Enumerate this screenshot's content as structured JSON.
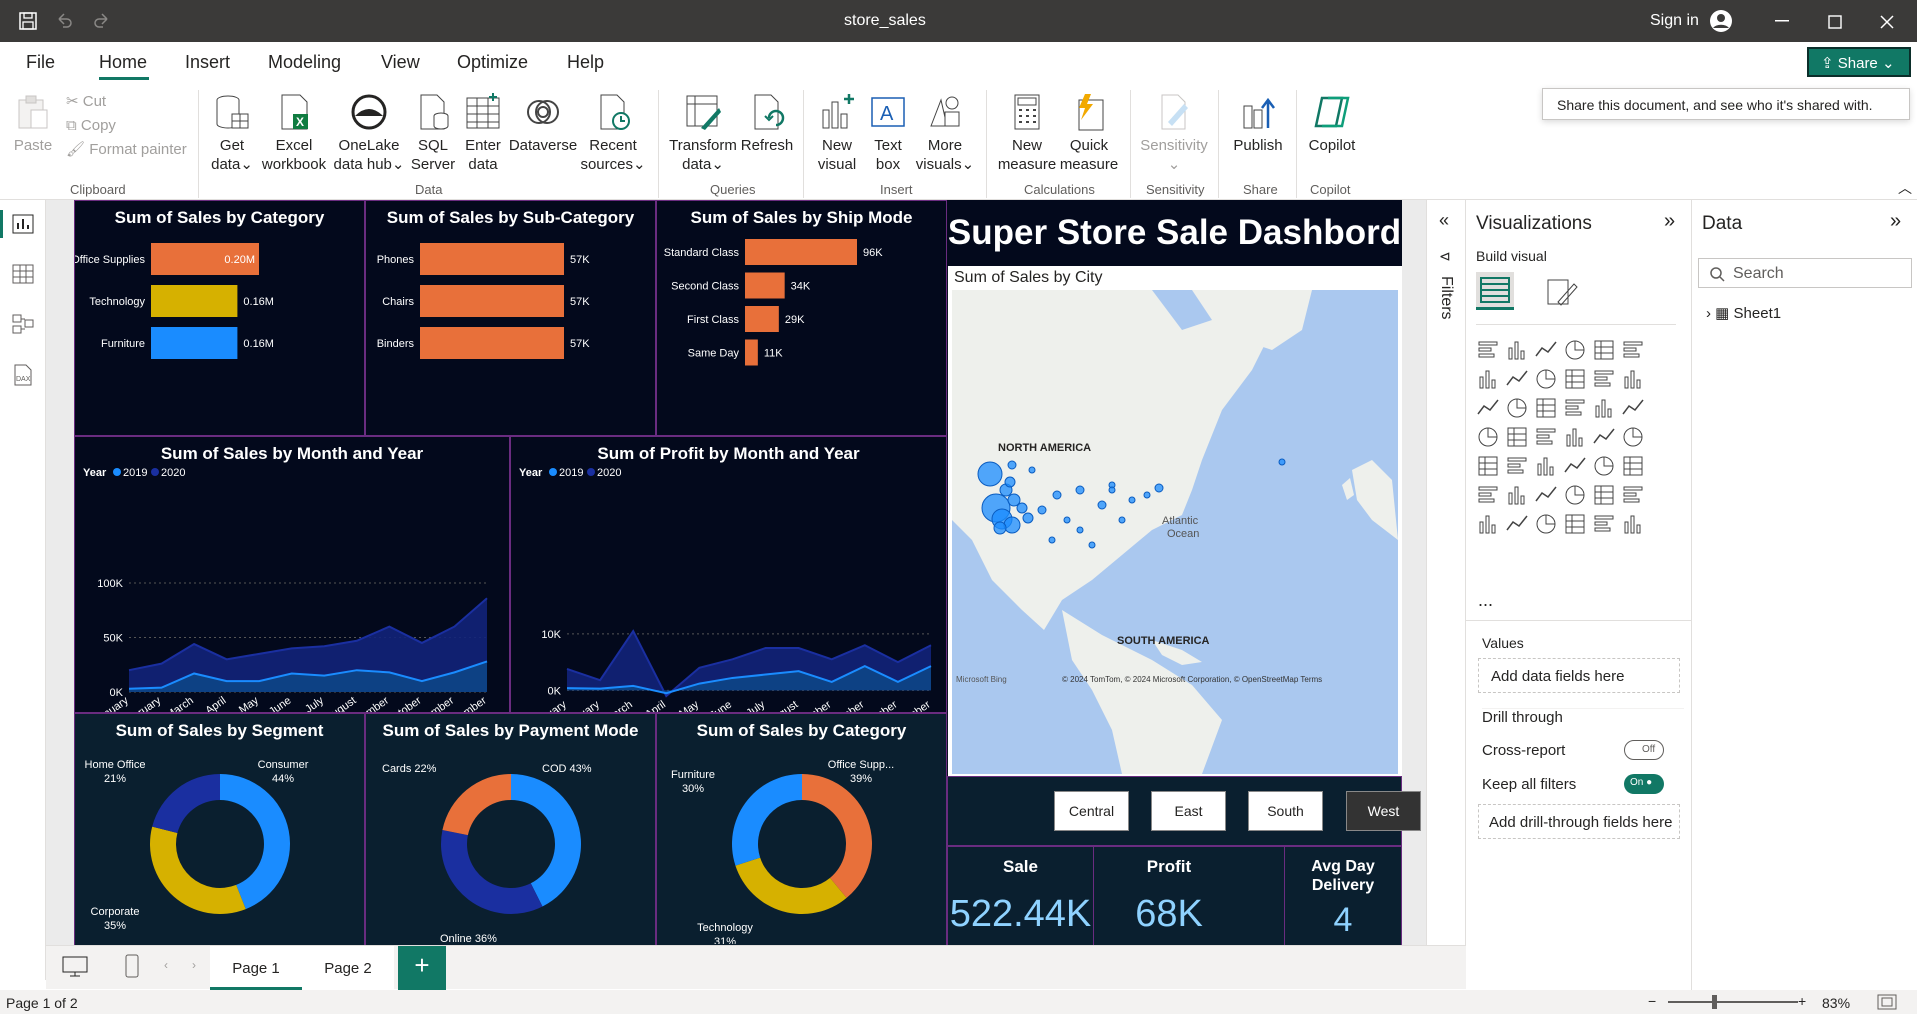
{
  "app": {
    "title": "store_sales",
    "sign_in": "Sign in"
  },
  "menu": [
    "File",
    "Home",
    "Insert",
    "Modeling",
    "View",
    "Optimize",
    "Help"
  ],
  "share": {
    "label": "Share",
    "tooltip": "Share this document, and see who it's shared with."
  },
  "ribbon": {
    "clipboard": {
      "paste": "Paste",
      "cut": "Cut",
      "copy": "Copy",
      "format_painter": "Format painter",
      "group": "Clipboard"
    },
    "data": {
      "get_data": [
        "Get",
        "data"
      ],
      "excel": [
        "Excel",
        "workbook"
      ],
      "onelake": [
        "OneLake",
        "data hub"
      ],
      "sql": [
        "SQL",
        "Server"
      ],
      "enter": [
        "Enter",
        "data"
      ],
      "dataverse": "Dataverse",
      "recent": [
        "Recent",
        "sources"
      ],
      "group": "Data"
    },
    "queries": {
      "transform": [
        "Transform",
        "data"
      ],
      "refresh": "Refresh",
      "group": "Queries"
    },
    "insert": {
      "new_visual": [
        "New",
        "visual"
      ],
      "text_box": [
        "Text",
        "box"
      ],
      "more_visuals": [
        "More",
        "visuals"
      ],
      "group": "Insert"
    },
    "calculations": {
      "new_measure": [
        "New",
        "measure"
      ],
      "quick_measure": [
        "Quick",
        "measure"
      ],
      "group": "Calculations"
    },
    "sensitivity": {
      "label": "Sensitivity",
      "group": "Sensitivity"
    },
    "share": {
      "publish": "Publish",
      "group": "Share"
    },
    "copilot": {
      "label": "Copilot",
      "group": "Copilot"
    }
  },
  "report": {
    "dashboard_title": "Super Store Sale Dashbord",
    "cat_bar": {
      "title": "Sum of Sales by Category",
      "labels": [
        "0.20M",
        "0.16M",
        "0.16M"
      ]
    },
    "sub_bar": {
      "title": "Sum of Sales by Sub-Category",
      "labels": [
        "57K",
        "57K",
        "57K"
      ]
    },
    "ship_bar": {
      "title": "Sum of Sales by Ship Mode",
      "labels": [
        "96K",
        "34K",
        "29K",
        "11K"
      ]
    },
    "sales_area": {
      "title": "Sum of Sales by Month and Year",
      "year_label": "Year",
      "y_ticks": [
        "100K",
        "50K",
        "0K"
      ]
    },
    "profit_area": {
      "title": "Sum of Profit by Month and Year",
      "year_label": "Year",
      "y_ticks": [
        "10K",
        "0K"
      ]
    },
    "map": {
      "title": "Sum of Sales by City",
      "north_america": "NORTH AMERICA",
      "south_america": "SOUTH AMERICA",
      "ocean": [
        "Atlantic",
        "Ocean"
      ],
      "bing": "Microsoft Bing",
      "copyright": "© 2024 TomTom, © 2024 Microsoft Corporation, © OpenStreetMap  Terms"
    },
    "segment_donut": {
      "title": "Sum of Sales by Segment"
    },
    "payment_donut": {
      "title": "Sum of Sales by Payment Mode"
    },
    "category_donut": {
      "title": "Sum of Sales by Category"
    },
    "regions": [
      "Central",
      "East",
      "South",
      "West"
    ],
    "kpi": {
      "sale_label": "Sale",
      "sale_value": "522.44K",
      "profit_label": "Profit",
      "profit_value": "68K",
      "delivery_label": [
        "Avg Day",
        "Delivery"
      ],
      "delivery_value": "4"
    }
  },
  "chart_data": [
    {
      "type": "bar",
      "title": "Sum of Sales by Category",
      "categories": [
        "Office Supplies",
        "Technology",
        "Furniture"
      ],
      "values": [
        0.2,
        0.16,
        0.16
      ],
      "unit": "M",
      "colors": [
        "#e8703a",
        "#d6b100",
        "#1a8cff"
      ]
    },
    {
      "type": "bar",
      "title": "Sum of Sales by Sub-Category",
      "categories": [
        "Phones",
        "Chairs",
        "Binders"
      ],
      "values": [
        57,
        57,
        57
      ],
      "unit": "K"
    },
    {
      "type": "bar",
      "title": "Sum of Sales by Ship Mode",
      "categories": [
        "Standard Class",
        "Second Class",
        "First Class",
        "Same Day"
      ],
      "values": [
        96,
        34,
        29,
        11
      ],
      "unit": "K"
    },
    {
      "type": "area",
      "title": "Sum of Sales by Month and Year",
      "categories": [
        "January",
        "February",
        "March",
        "April",
        "May",
        "June",
        "July",
        "August",
        "September",
        "October",
        "November",
        "December"
      ],
      "ylim": [
        0,
        100
      ],
      "y_unit": "K",
      "series": [
        {
          "name": "2019",
          "values": [
            3,
            4,
            17,
            10,
            10,
            17,
            15,
            20,
            18,
            10,
            18,
            28
          ]
        },
        {
          "name": "2020",
          "values": [
            20,
            26,
            44,
            30,
            35,
            40,
            42,
            47,
            60,
            45,
            60,
            86
          ]
        }
      ]
    },
    {
      "type": "area",
      "title": "Sum of Profit by Month and Year",
      "categories": [
        "January",
        "February",
        "March",
        "April",
        "May",
        "June",
        "July",
        "August",
        "September",
        "October",
        "November",
        "December"
      ],
      "ylim": [
        -1,
        13
      ],
      "y_unit": "K",
      "series": [
        {
          "name": "2019",
          "values": [
            0.4,
            0.3,
            0.8,
            -0.5,
            1.2,
            2.2,
            2.8,
            3.4,
            1.5,
            4.3,
            1.5,
            4.3
          ]
        },
        {
          "name": "2020",
          "values": [
            3.8,
            1.8,
            10.5,
            -1,
            4,
            5.5,
            7.5,
            7.5,
            5.5,
            8,
            5,
            8
          ]
        }
      ]
    },
    {
      "type": "pie",
      "title": "Sum of Sales by Segment",
      "categories": [
        "Consumer",
        "Corporate",
        "Home Office"
      ],
      "values": [
        44,
        35,
        21
      ],
      "labels": [
        "Consumer 44%",
        "Corporate 35%",
        "Home Office 21%"
      ],
      "colors": [
        "#1a8cff",
        "#d6b100",
        "#1a2fa0"
      ]
    },
    {
      "type": "pie",
      "title": "Sum of Sales by Payment Mode",
      "categories": [
        "COD",
        "Online",
        "Cards"
      ],
      "values": [
        43,
        36,
        22
      ],
      "labels": [
        "COD 43%",
        "Online 36%",
        "Cards 22%"
      ],
      "colors": [
        "#1a8cff",
        "#1a2fa0",
        "#e8703a"
      ]
    },
    {
      "type": "pie",
      "title": "Sum of Sales by Category",
      "categories": [
        "Office Supp...",
        "Technology",
        "Furniture"
      ],
      "values": [
        39,
        31,
        30
      ],
      "labels": [
        "Office Supp... 39%",
        "Technology 31%",
        "Furniture 30%"
      ],
      "colors": [
        "#e8703a",
        "#d6b100",
        "#1a8cff"
      ]
    }
  ],
  "visualizations": {
    "title": "Visualizations",
    "build": "Build visual",
    "values": "Values",
    "add_fields": "Add data fields here",
    "drill": "Drill through",
    "cross": "Cross-report",
    "cross_state": "Off",
    "keep": "Keep all filters",
    "keep_state": "On",
    "add_drill": "Add drill-through fields here",
    "more": "..."
  },
  "filters": {
    "label": "Filters"
  },
  "data_pane": {
    "title": "Data",
    "search": "Search",
    "table": "Sheet1"
  },
  "pages": [
    "Page 1",
    "Page 2"
  ],
  "status": {
    "page": "Page 1 of 2",
    "zoom": "83%"
  }
}
